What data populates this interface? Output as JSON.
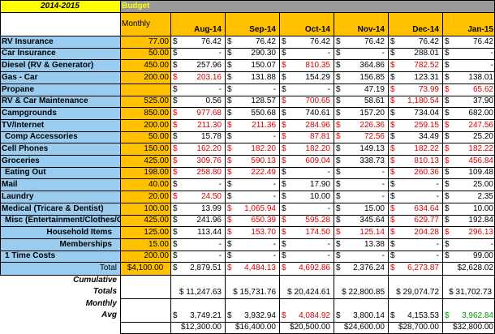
{
  "header": {
    "year": "2014-2015",
    "budget_title": "Budget",
    "monthly_label": "Monthly",
    "months": [
      "Aug-14",
      "Sep-14",
      "Oct-14",
      "Nov-14",
      "Dec-14",
      "Jan-15"
    ]
  },
  "colors": {
    "yellow": "#ffff00",
    "blue": "#99ccee",
    "orange": "#ffc000",
    "gray": "#999999",
    "red": "#e00000",
    "green": "#00a000"
  },
  "rows": [
    {
      "label": "RV Insurance",
      "budget": "77.00",
      "values": [
        {
          "v": "76.42"
        },
        {
          "v": "76.42"
        },
        {
          "v": "76.42"
        },
        {
          "v": "76.42"
        },
        {
          "v": "76.42"
        },
        {
          "v": "76.42"
        }
      ]
    },
    {
      "label": "Car Insurance",
      "budget": "50.00",
      "values": [
        {
          "v": "-"
        },
        {
          "v": "290.30"
        },
        {
          "v": "-"
        },
        {
          "v": "-"
        },
        {
          "v": "288.01"
        },
        {
          "v": "-"
        }
      ]
    },
    {
      "label": "Diesel (RV & Generator)",
      "budget": "450.00",
      "values": [
        {
          "v": "257.96"
        },
        {
          "v": "150.07"
        },
        {
          "v": "810.35",
          "c": "red"
        },
        {
          "v": "364.86"
        },
        {
          "v": "782.52",
          "c": "red"
        },
        {
          "v": "-"
        }
      ]
    },
    {
      "label": "Gas - Car",
      "budget": "200.00",
      "values": [
        {
          "v": "203.16",
          "c": "red"
        },
        {
          "v": "131.88"
        },
        {
          "v": "154.29"
        },
        {
          "v": "156.85"
        },
        {
          "v": "123.31"
        },
        {
          "v": "138.01"
        }
      ]
    },
    {
      "label": "Propane",
      "budget": "",
      "values": [
        {
          "v": "-"
        },
        {
          "v": "-"
        },
        {
          "v": "-"
        },
        {
          "v": "47.19"
        },
        {
          "v": "73.99",
          "c": "red"
        },
        {
          "v": "65.62",
          "c": "red"
        }
      ]
    },
    {
      "label": "RV & Car Maintenance",
      "budget": "525.00",
      "values": [
        {
          "v": "0.56"
        },
        {
          "v": "128.57"
        },
        {
          "v": "700.65",
          "c": "red"
        },
        {
          "v": "58.61"
        },
        {
          "v": "1,180.54",
          "c": "red"
        },
        {
          "v": "37.90"
        }
      ]
    },
    {
      "label": "Campgrounds",
      "budget": "850.00",
      "values": [
        {
          "v": "977.68",
          "c": "red"
        },
        {
          "v": "550.68"
        },
        {
          "v": "740.61"
        },
        {
          "v": "157.20"
        },
        {
          "v": "734.04"
        },
        {
          "v": "682.00"
        }
      ]
    },
    {
      "label": "TV/Internet",
      "budget": "200.00",
      "values": [
        {
          "v": "211.30",
          "c": "red"
        },
        {
          "v": "211.36",
          "c": "red"
        },
        {
          "v": "284.96",
          "c": "red"
        },
        {
          "v": "226.36",
          "c": "red"
        },
        {
          "v": "259.15",
          "c": "red"
        },
        {
          "v": "247.56",
          "c": "red"
        }
      ]
    },
    {
      "label": "Comp Accessories",
      "indent": true,
      "budget": "50.00",
      "values": [
        {
          "v": "15.78"
        },
        {
          "v": "-"
        },
        {
          "v": "87.81",
          "c": "red"
        },
        {
          "v": "72.56",
          "c": "red"
        },
        {
          "v": "34.49"
        },
        {
          "v": "25.20"
        }
      ]
    },
    {
      "label": "Cell Phones",
      "budget": "150.00",
      "values": [
        {
          "v": "162.20",
          "c": "red"
        },
        {
          "v": "182.20",
          "c": "red"
        },
        {
          "v": "182.20",
          "c": "red"
        },
        {
          "v": "149.13"
        },
        {
          "v": "182.22",
          "c": "red"
        },
        {
          "v": "182.22",
          "c": "red"
        }
      ]
    },
    {
      "label": "Groceries",
      "budget": "425.00",
      "values": [
        {
          "v": "309.76",
          "c": "red"
        },
        {
          "v": "590.13",
          "c": "red"
        },
        {
          "v": "609.04",
          "c": "red"
        },
        {
          "v": "338.73"
        },
        {
          "v": "810.13",
          "c": "red"
        },
        {
          "v": "456.84",
          "c": "red"
        }
      ]
    },
    {
      "label": "Eating Out",
      "indent": true,
      "budget": "198.00",
      "values": [
        {
          "v": "258.80",
          "c": "red"
        },
        {
          "v": "222.49",
          "c": "red"
        },
        {
          "v": "-"
        },
        {
          "v": "-"
        },
        {
          "v": "260.36",
          "c": "red"
        },
        {
          "v": "109.48"
        }
      ]
    },
    {
      "label": "Mail",
      "budget": "40.00",
      "values": [
        {
          "v": "-"
        },
        {
          "v": "-"
        },
        {
          "v": "17.90"
        },
        {
          "v": "-"
        },
        {
          "v": "-"
        },
        {
          "v": "25.00"
        }
      ]
    },
    {
      "label": "Laundry",
      "budget": "20.00",
      "values": [
        {
          "v": "24.50",
          "c": "red"
        },
        {
          "v": "-"
        },
        {
          "v": "10.00"
        },
        {
          "v": "-"
        },
        {
          "v": "-"
        },
        {
          "v": "2.35"
        }
      ]
    },
    {
      "label": "Medical (Tricare & Dentist)",
      "budget": "100.00",
      "values": [
        {
          "v": "13.99"
        },
        {
          "v": "1,065.94",
          "c": "red"
        },
        {
          "v": "-"
        },
        {
          "v": "15.00"
        },
        {
          "v": "634.64",
          "c": "red"
        },
        {
          "v": "10.00"
        }
      ]
    },
    {
      "label": "Misc (Entertainment/Clothes/Gifts)",
      "indent": true,
      "budget": "425.00",
      "values": [
        {
          "v": "241.96"
        },
        {
          "v": "650.39",
          "c": "red"
        },
        {
          "v": "595.28",
          "c": "red"
        },
        {
          "v": "345.64"
        },
        {
          "v": "629.77",
          "c": "red"
        },
        {
          "v": "192.84"
        }
      ]
    },
    {
      "label": "Household Items",
      "align": "right",
      "budget": "125.00",
      "values": [
        {
          "v": "113.44"
        },
        {
          "v": "153.70",
          "c": "red"
        },
        {
          "v": "174.50",
          "c": "red"
        },
        {
          "v": "125.14",
          "c": "red"
        },
        {
          "v": "204.28",
          "c": "red"
        },
        {
          "v": "296.13",
          "c": "red"
        }
      ]
    },
    {
      "label": "Memberships",
      "align": "right",
      "budget": "15.00",
      "values": [
        {
          "v": "-"
        },
        {
          "v": "-"
        },
        {
          "v": "-"
        },
        {
          "v": "13.38"
        },
        {
          "v": "-"
        },
        {
          "v": "-"
        }
      ]
    },
    {
      "label": "1 Time Costs",
      "indent": true,
      "budget": "200.00",
      "values": [
        {
          "v": "-"
        },
        {
          "v": "-"
        },
        {
          "v": "-"
        },
        {
          "v": "-"
        },
        {
          "v": "-"
        },
        {
          "v": "99.00"
        }
      ]
    }
  ],
  "total": {
    "label": "Total",
    "budget": "$4,100.00",
    "values": [
      {
        "v": "2,879.51"
      },
      {
        "v": "4,484.13",
        "c": "red"
      },
      {
        "v": "4,692.86",
        "c": "red"
      },
      {
        "v": "2,376.24"
      },
      {
        "v": "6,273.87",
        "c": "red"
      },
      {
        "v": "$2,628.02",
        "nodollar": true
      }
    ]
  },
  "cumulative": {
    "label1": "Cumulative",
    "label2": "Totals",
    "values": [
      {
        "v": "$ 11,247.63"
      },
      {
        "v": "$ 15,731.76"
      },
      {
        "v": "$ 20,424.61"
      },
      {
        "v": "$ 22,800.85"
      },
      {
        "v": "$ 29,074.72"
      },
      {
        "v": "$ 31,702.73"
      }
    ]
  },
  "monthly_avg": {
    "label1": "Monthly",
    "label2": "Avg",
    "values": [
      {
        "v": "3,749.21"
      },
      {
        "v": "3,932.94"
      },
      {
        "v": "4,084.92",
        "c": "red"
      },
      {
        "v": "3,800.14"
      },
      {
        "v": "4,153.53"
      },
      {
        "v": "3,962.84",
        "c": "green"
      }
    ]
  },
  "budget_cumulative": [
    "$12,300.00",
    "$16,400.00",
    "$20,500.00",
    "$24,600.00",
    "$28,700.00",
    "$32,800.00"
  ]
}
